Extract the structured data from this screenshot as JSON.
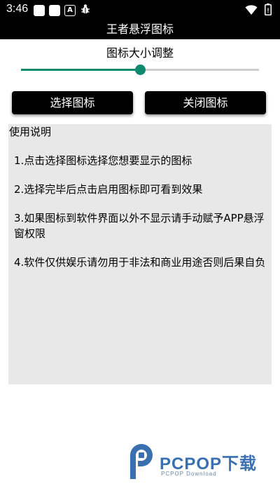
{
  "status_bar": {
    "time": "3:46",
    "left_icons": [
      "square-notification-icon",
      "square-notification-icon",
      "a-notification-icon",
      "bug-icon"
    ],
    "right_icons": [
      "wifi-icon",
      "battery-icon"
    ]
  },
  "app_bar": {
    "title": "王者悬浮图标"
  },
  "slider": {
    "label": "图标大小调整",
    "value_fraction": 0.5,
    "accent_color": "#0f8a6e"
  },
  "buttons": {
    "select_label": "选择图标",
    "close_label": "关闭图标"
  },
  "instructions": {
    "heading": "使用说明",
    "steps": [
      "1.点击选择图标选择您想要显示的图标",
      "2.选择完毕后点击启用图标即可看到效果",
      "3.如果图标到软件界面以外不显示请手动赋予APP悬浮窗权限",
      "4.软件仅供娱乐请勿用于非法和商业用途否则后果自负"
    ]
  },
  "watermark": {
    "title": "PCPOP下载",
    "subtitle": "PCPOP Download"
  }
}
